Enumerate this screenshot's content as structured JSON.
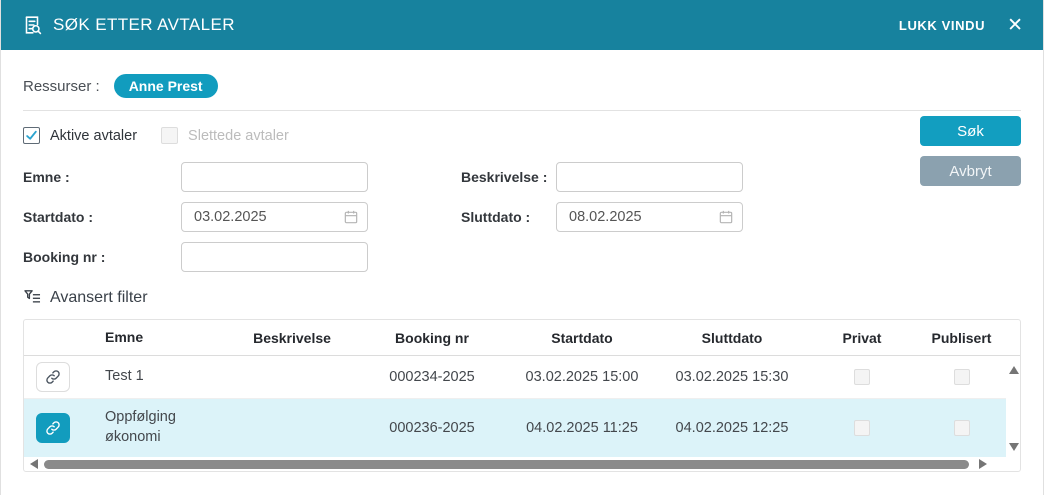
{
  "header": {
    "title": "SØK ETTER AVTALER",
    "close_label": "LUKK VINDU",
    "close_icon": "✕"
  },
  "resources": {
    "label": "Ressurser :",
    "pill": "Anne Prest"
  },
  "filters": {
    "active_checkbox_label": "Aktive avtaler",
    "active_checked": true,
    "deleted_checkbox_label": "Slettede avtaler",
    "deleted_checked": false,
    "emne_label": "Emne :",
    "emne_value": "",
    "beskrivelse_label": "Beskrivelse :",
    "beskrivelse_value": "",
    "startdato_label": "Startdato :",
    "startdato_value": "03.02.2025",
    "sluttdato_label": "Sluttdato :",
    "sluttdato_value": "08.02.2025",
    "booking_label": "Booking nr :",
    "booking_value": "",
    "search_button": "Søk",
    "cancel_button": "Avbryt",
    "advanced_filter_label": "Avansert filter"
  },
  "table": {
    "headers": {
      "emne": "Emne",
      "beskrivelse": "Beskrivelse",
      "booking": "Booking nr",
      "startdato": "Startdato",
      "sluttdato": "Sluttdato",
      "privat": "Privat",
      "publisert": "Publisert"
    },
    "rows": [
      {
        "emne": "Test 1",
        "beskrivelse": "",
        "booking": "000234-2025",
        "startdato": "03.02.2025 15:00",
        "sluttdato": "03.02.2025 15:30",
        "privat": false,
        "publisert": false,
        "selected": false
      },
      {
        "emne": "Oppfølging økonomi",
        "beskrivelse": "",
        "booking": "000236-2025",
        "startdato": "04.02.2025 11:25",
        "sluttdato": "04.02.2025 12:25",
        "privat": false,
        "publisert": false,
        "selected": true
      }
    ]
  },
  "colors": {
    "header_bg": "#17829E",
    "accent_teal": "#129CBE",
    "cancel_gray": "#8BA1AF",
    "selected_row_bg": "#DCF3F9",
    "check_mark": "#2AA3CF"
  }
}
